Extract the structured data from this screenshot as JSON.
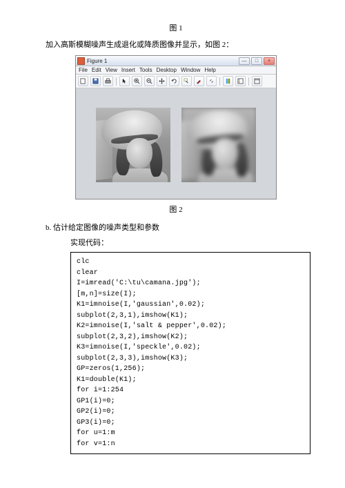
{
  "figure1_label": "图 1",
  "intro_text": "加入高斯模糊噪声生成退化或降质图像并显示，如图 2：",
  "figwin": {
    "title": "Figure 1",
    "menus": [
      "File",
      "Edit",
      "View",
      "Insert",
      "Tools",
      "Desktop",
      "Window",
      "Help"
    ],
    "winbtns": {
      "min": "—",
      "max": "□",
      "close": "×"
    }
  },
  "figure2_label": "图 2",
  "section_b": "b. 估计给定图像的噪声类型和参数",
  "code_caption": "实现代码：",
  "code": "clc\nclear\nI=imread('C:\\tu\\camana.jpg');\n[m,n]=size(I);\nK1=imnoise(I,'gaussian',0.02);\nsubplot(2,3,1),imshow(K1);\nK2=imnoise(I,'salt & pepper',0.02);\nsubplot(2,3,2),imshow(K2);\nK3=imnoise(I,'speckle',0.02);\nsubplot(2,3,3),imshow(K3);\nGP=zeros(1,256);\nK1=double(K1);\nfor i=1:254\nGP1(i)=0;\nGP2(i)=0;\nGP3(i)=0;\nfor u=1:m\nfor v=1:n"
}
